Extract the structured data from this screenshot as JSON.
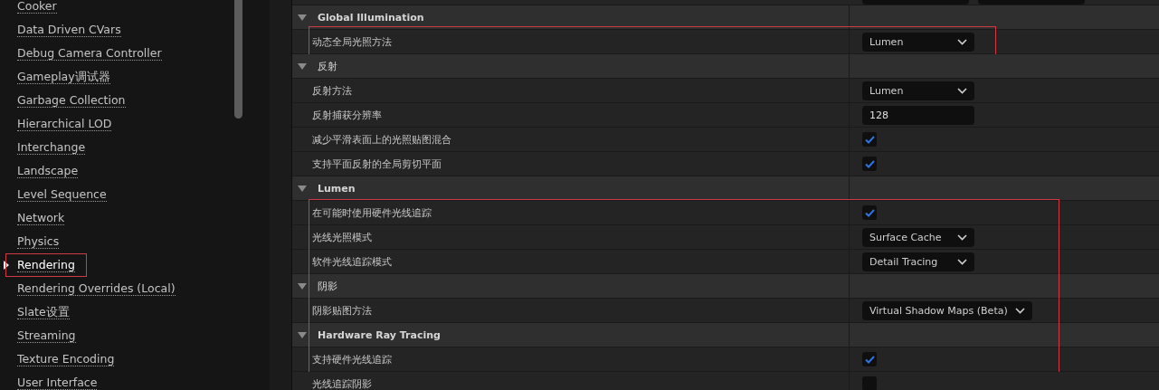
{
  "sidebar": {
    "items": [
      {
        "label": "Cooker",
        "selected": false,
        "framed": false
      },
      {
        "label": "Data Driven CVars",
        "selected": false,
        "framed": false
      },
      {
        "label": "Debug Camera Controller",
        "selected": false,
        "framed": false
      },
      {
        "label": "Gameplay调试器",
        "selected": false,
        "framed": false
      },
      {
        "label": "Garbage Collection",
        "selected": false,
        "framed": false
      },
      {
        "label": "Hierarchical LOD",
        "selected": false,
        "framed": false
      },
      {
        "label": "Interchange",
        "selected": false,
        "framed": false
      },
      {
        "label": "Landscape",
        "selected": false,
        "framed": false
      },
      {
        "label": "Level Sequence",
        "selected": false,
        "framed": false
      },
      {
        "label": "Network",
        "selected": false,
        "framed": false
      },
      {
        "label": "Physics",
        "selected": false,
        "framed": false
      },
      {
        "label": "Rendering",
        "selected": true,
        "framed": true
      },
      {
        "label": "Rendering Overrides (Local)",
        "selected": false,
        "framed": false
      },
      {
        "label": "Slate设置",
        "selected": false,
        "framed": false
      },
      {
        "label": "Streaming",
        "selected": false,
        "framed": false
      },
      {
        "label": "Texture Encoding",
        "selected": false,
        "framed": false
      },
      {
        "label": "User Interface",
        "selected": false,
        "framed": false
      }
    ]
  },
  "details": {
    "blocks": [
      {
        "framed": false,
        "items": [
          {
            "kind": "header",
            "label": "Global Illumination",
            "expanded": true,
            "bold": true
          }
        ]
      },
      {
        "framed": true,
        "items": [
          {
            "kind": "dropdown",
            "label": "动态全局光照方法",
            "value": "Lumen"
          }
        ]
      },
      {
        "framed": false,
        "items": [
          {
            "kind": "header",
            "label": "反射",
            "expanded": true,
            "bold": false
          },
          {
            "kind": "dropdown",
            "label": "反射方法",
            "value": "Lumen"
          },
          {
            "kind": "number",
            "label": "反射捕获分辨率",
            "value": "128"
          },
          {
            "kind": "checkbox",
            "label": "减少平滑表面上的光照贴图混合",
            "checked": true
          },
          {
            "kind": "checkbox",
            "label": "支持平面反射的全局剪切平面",
            "checked": true
          },
          {
            "kind": "header",
            "label": "Lumen",
            "expanded": true,
            "bold": true
          }
        ]
      },
      {
        "framed": true,
        "items": [
          {
            "kind": "checkbox",
            "label": "在可能时使用硬件光线追踪",
            "checked": true
          },
          {
            "kind": "dropdown",
            "label": "光线光照模式",
            "value": "Surface Cache"
          },
          {
            "kind": "dropdown",
            "label": "软件光线追踪模式",
            "value": "Detail Tracing"
          },
          {
            "kind": "header",
            "label": "阴影",
            "expanded": true,
            "bold": false
          },
          {
            "kind": "dropdown",
            "label": "阴影贴图方法",
            "value": "Virtual Shadow Maps (Beta)"
          },
          {
            "kind": "header",
            "label": "Hardware Ray Tracing",
            "expanded": true,
            "bold": true
          },
          {
            "kind": "checkbox",
            "label": "支持硬件光线追踪",
            "checked": true
          }
        ]
      },
      {
        "framed": false,
        "items": [
          {
            "kind": "checkbox",
            "label": "光线追踪阴影",
            "checked": false
          }
        ]
      }
    ]
  }
}
